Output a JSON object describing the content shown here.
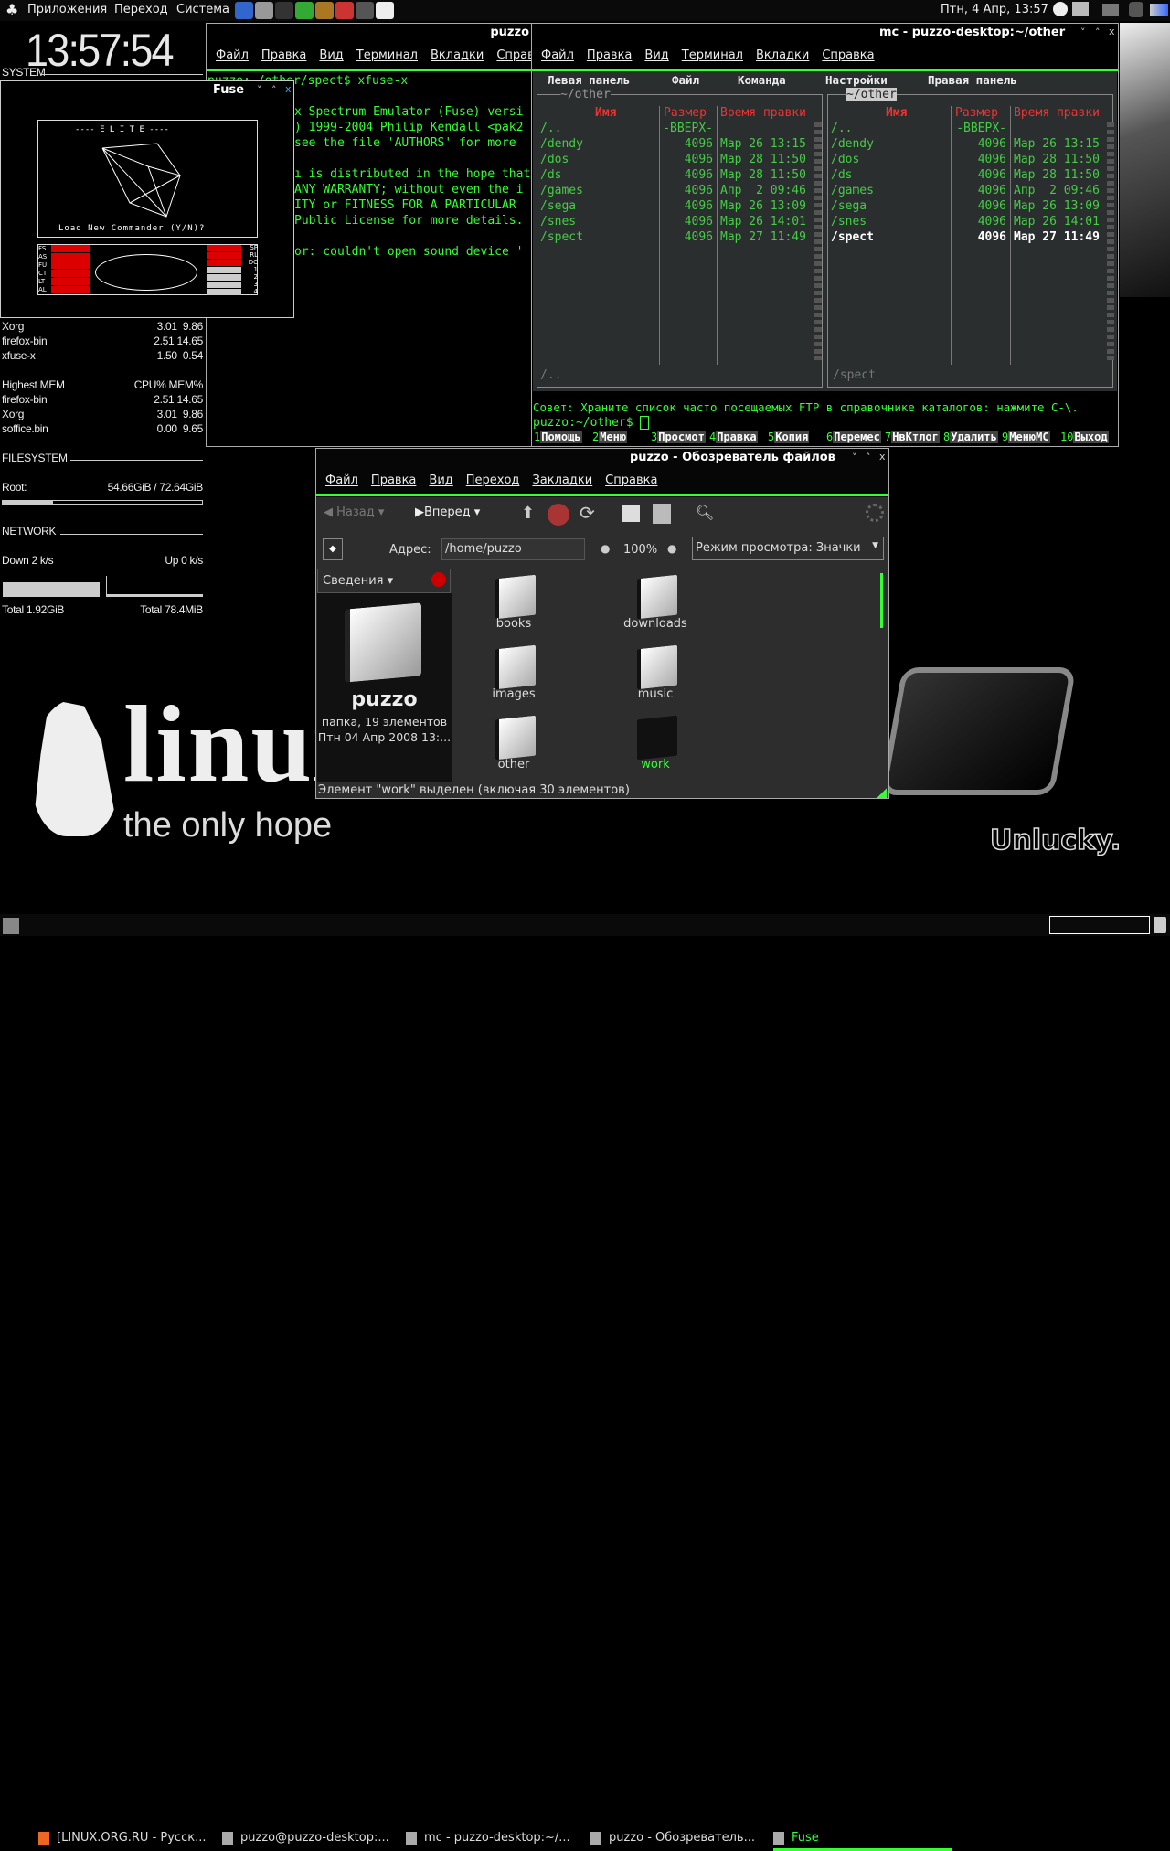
{
  "panel": {
    "menus": [
      "Приложения",
      "Переход",
      "Система"
    ],
    "clock": "Птн,  4 Апр, 13:57",
    "launchers": [
      "epiphany-icon",
      "gimp-icon",
      "terminal-icon",
      "vim-icon",
      "dosbox-icon",
      "znes-icon",
      "vmware-icon",
      "opera-icon"
    ]
  },
  "conky": {
    "time": "13:57:54",
    "system_label": "SYSTEM",
    "cpu_procs": [
      [
        "Xorg",
        "3.01  9.86"
      ],
      [
        "firefox-bin",
        "2.51 14.65"
      ],
      [
        "xfuse-x",
        "1.50  0.54"
      ]
    ],
    "mem_header": [
      "Highest MEM",
      "CPU% MEM%"
    ],
    "mem_procs": [
      [
        "firefox-bin",
        "2.51 14.65"
      ],
      [
        "Xorg",
        "3.01  9.86"
      ],
      [
        "soffice.bin",
        "0.00  9.65"
      ]
    ],
    "filesystem_label": "FILESYSTEM",
    "root_label": "Root:",
    "root_value": "54.66GiB / 72.64GiB",
    "root_usage_percent": 25,
    "network_label": "NETWORK",
    "down": "Down 2 k/s",
    "up": "Up 0 k/s",
    "total_down": "Total 1.92GiB",
    "total_up": "Total 78.4MiB"
  },
  "fuse": {
    "title": "Fuse",
    "elite_title": "---- E L I T E ----",
    "prompt": "Load New Commander (Y/N)?",
    "gauges_left": [
      "FS",
      "AS",
      "FU",
      "CT",
      "LT",
      "AL"
    ],
    "gauges_right": [
      "SP",
      "RL",
      "DC",
      "1",
      "2",
      "3",
      "4"
    ]
  },
  "terminal": {
    "title": "puzzo",
    "menu": [
      "Файл",
      "Правка",
      "Вид",
      "Терминал",
      "Вкладки",
      "Справ"
    ],
    "lines": [
      "puzzo:~/other/spect$ xfuse-x",
      "",
      "x Spectrum Emulator (Fuse) versi",
      ") 1999-2004 Philip Kendall <pak2",
      "see the file 'AUTHORS' for more",
      "",
      "ı is distributed in the hope that",
      "ANY WARRANTY; without even the i",
      "ITY or FITNESS FOR A PARTICULAR",
      "Public License for more details.",
      "",
      "or: couldn't open sound device '"
    ]
  },
  "mc": {
    "title": "mc - puzzo-desktop:~/other",
    "menu": [
      "Файл",
      "Правка",
      "Вид",
      "Терминал",
      "Вкладки",
      "Справка"
    ],
    "top_menu": [
      "Левая панель",
      "Файл",
      "Команда",
      "Настройки",
      "Правая панель"
    ],
    "left_path": "~/other",
    "right_path": "~/other",
    "columns": [
      "Имя",
      "Размер",
      "Время правки"
    ],
    "rows": [
      [
        "/..",
        "-ВВЕРХ-",
        ""
      ],
      [
        "/dendy",
        "4096",
        "Мар 26 13:15"
      ],
      [
        "/dos",
        "4096",
        "Мар 28 11:50"
      ],
      [
        "/ds",
        "4096",
        "Мар 28 11:50"
      ],
      [
        "/games",
        "4096",
        "Апр  2 09:46"
      ],
      [
        "/sega",
        "4096",
        "Мар 26 13:09"
      ],
      [
        "/snes",
        "4096",
        "Мар 26 14:01"
      ],
      [
        "/spect",
        "4096",
        "Мар 27 11:49"
      ]
    ],
    "left_status": "/..",
    "right_status": "/spect",
    "hint": "Совет: Храните список часто посещаемых FTP в справочнике каталогов: нажмите C-\\.",
    "prompt": "puzzo:~/other$ ",
    "fkeys": [
      [
        "1",
        "Помощь"
      ],
      [
        "2",
        "Меню"
      ],
      [
        "3",
        "Просмот"
      ],
      [
        "4",
        "Правка"
      ],
      [
        "5",
        "Копия"
      ],
      [
        "6",
        "Перемес"
      ],
      [
        "7",
        "НвКтлог"
      ],
      [
        "8",
        "Удалить"
      ],
      [
        "9",
        "МенюМС"
      ],
      [
        "10",
        "Выход"
      ]
    ]
  },
  "nautilus": {
    "title": "puzzo - Обозреватель файлов",
    "menu": [
      "Файл",
      "Правка",
      "Вид",
      "Переход",
      "Закладки",
      "Справка"
    ],
    "back": "Назад",
    "forward": "Вперед",
    "address_label": "Адрес:",
    "address": "/home/puzzo",
    "zoom": "100%",
    "view_mode": "Режим просмотра: Значки",
    "sidebar_title": "Сведения",
    "folder_name": "puzzo",
    "folder_info": "папка, 19 элементов",
    "folder_date": "Птн 04 Апр 2008 13:...",
    "items": [
      "books",
      "downloads",
      "images",
      "music",
      "other",
      "work"
    ],
    "selected": "work",
    "status": "Элемент \"work\" выделен (включая 30 элементов)"
  },
  "wallpaper": {
    "text1": "linux",
    "text2": "the only hope",
    "text3": "Unlucky."
  },
  "taskbar": {
    "items": [
      "[LINUX.ORG.RU - Русск...",
      "puzzo@puzzo-desktop:...",
      "mc - puzzo-desktop:~/...",
      "puzzo - Обозреватель...",
      "Fuse"
    ],
    "active": "Fuse"
  },
  "colors": {
    "accent": "#33ff33",
    "mc_header": "#ee3333",
    "mc_text": "#44cc44"
  }
}
